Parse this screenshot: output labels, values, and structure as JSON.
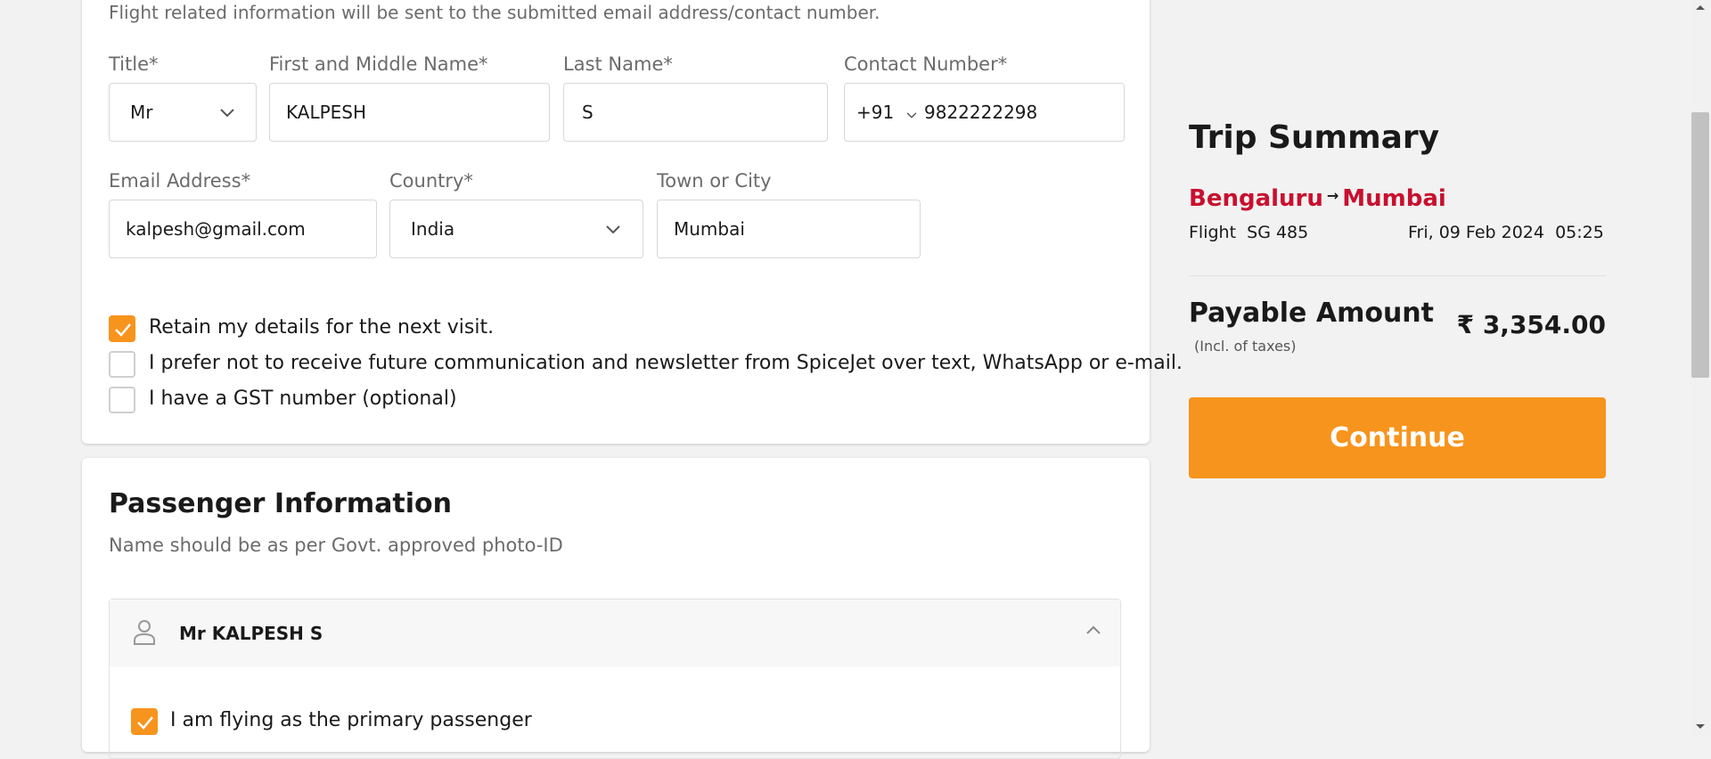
{
  "contact": {
    "info_text": "Flight related information will be sent to the submitted email address/contact number.",
    "title_label": "Title*",
    "title_value": "Mr",
    "first_name_label": "First and Middle Name*",
    "first_name_value": "KALPESH",
    "last_name_label": "Last Name*",
    "last_name_value": "S",
    "contact_label": "Contact Number*",
    "country_code": "+91",
    "contact_value": "9822222298",
    "email_label": "Email Address*",
    "email_value": "kalpesh@gmail.com",
    "country_label": "Country*",
    "country_value": "India",
    "city_label": "Town or City",
    "city_value": "Mumbai",
    "checkboxes": [
      {
        "label": "Retain my details for the next visit.",
        "checked": true
      },
      {
        "label": "I prefer not to receive future communication and newsletter from SpiceJet over text, WhatsApp or e-mail.",
        "checked": false
      },
      {
        "label": "I have a GST number (optional)",
        "checked": false
      }
    ]
  },
  "passenger": {
    "heading": "Passenger Information",
    "subtext": "Name should be as per Govt. approved photo-ID",
    "name": "Mr KALPESH S",
    "primary_label": "I am flying as the primary passenger",
    "primary_checked": true
  },
  "summary": {
    "heading": "Trip Summary",
    "from": "Bengaluru",
    "arrow": "→",
    "to": "Mumbai",
    "flight_label": "Flight",
    "flight_number": "SG 485",
    "date": "Fri, 09 Feb 2024",
    "time": "05:25",
    "payable_label": "Payable Amount",
    "taxes_note": "(Incl. of taxes)",
    "amount": "₹ 3,354.00",
    "continue_label": "Continue"
  },
  "colors": {
    "accent": "#f7941d",
    "route_red": "#c8102e",
    "checkbox_on": "#f7941d"
  }
}
